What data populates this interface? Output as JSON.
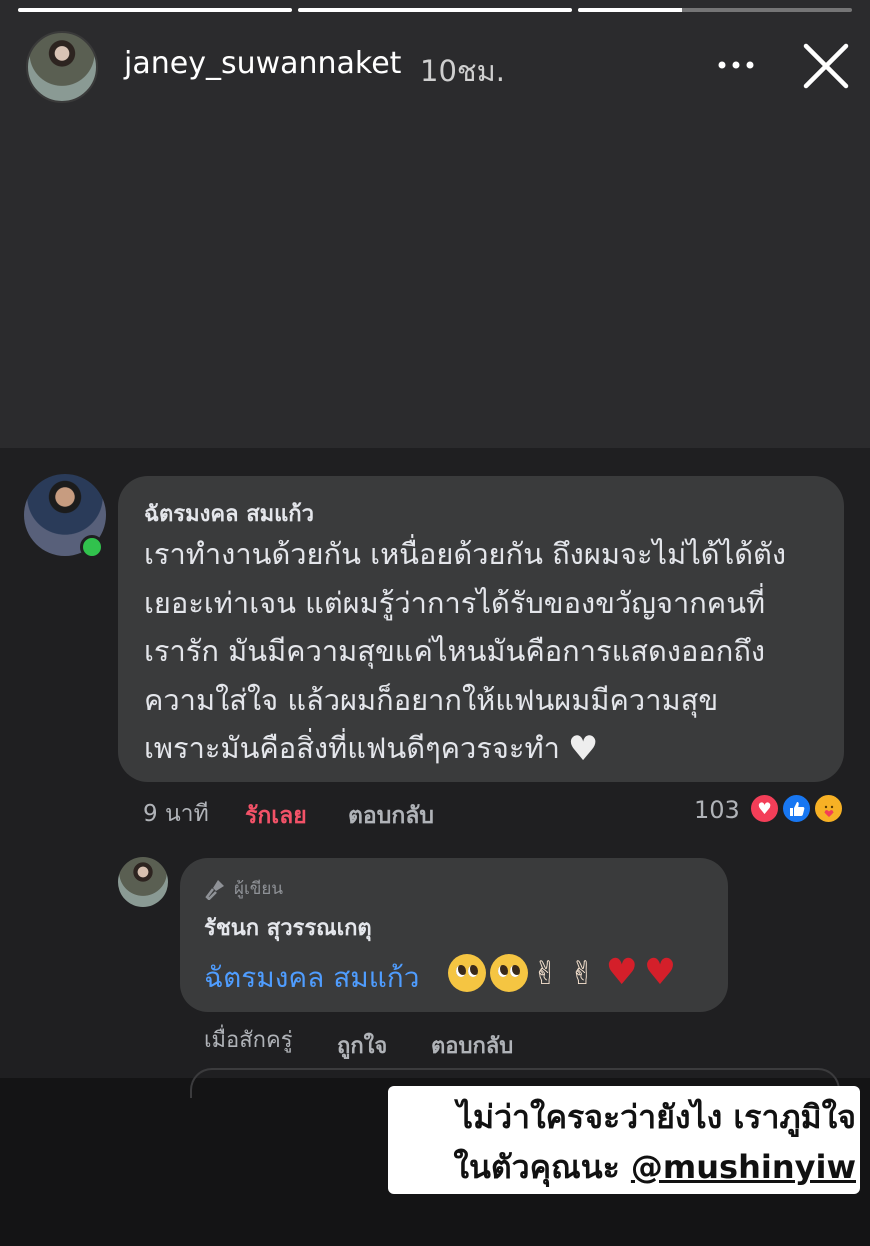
{
  "story": {
    "progress": [
      1,
      1,
      0.38
    ],
    "username": "janey_suwannaket",
    "time_ago": "10ชม."
  },
  "comment": {
    "author": "ฉัตรมงคล สมแก้ว",
    "text": "เราทำงานด้วยกัน เหนื่อยด้วยกัน ถึงผมจะไม่ได้ได้ตัง\nเยอะเท่าเจน แต่ผมรู้ว่าการได้รับของขวัญจากคนที่\nเรารัก มันมีความสุขแค่ไหนมันคือการแสดงออกถึง\nความใส่ใจ แล้วผมก็อยากให้แฟนผมมีความสุข\nเพราะมันคือสิ่งที่แฟนดีๆควรจะทำ",
    "time": "9 นาที",
    "like_label": "รักเลย",
    "reply_label": "ตอบกลับ",
    "reaction_count": "103",
    "reactions": [
      "love-reaction",
      "like-reaction",
      "care-reaction"
    ]
  },
  "reply": {
    "author_badge": "ผู้เขียน",
    "author": "รัชนก สุวรรณเกตุ",
    "mention": "ฉัตรมงคล สมแก้ว",
    "emojis": [
      "pleading-face",
      "pleading-face",
      "victory-hand",
      "victory-hand",
      "red-heart",
      "red-heart"
    ],
    "time": "เมื่อสักครู่",
    "like_label": "ถูกใจ",
    "reply_label": "ตอบกลับ"
  },
  "caption": {
    "line1": "ไม่ว่าใครจะว่ายังไง เราภูมิใจ",
    "line2_prefix": "ในตัวคุณนะ ",
    "handle": "@mushinyiw"
  },
  "colors": {
    "background": "#1f1f21",
    "bubble": "#3a3b3c",
    "love_text": "#f25268",
    "mention": "#4f9dff",
    "online": "#31c24d"
  }
}
